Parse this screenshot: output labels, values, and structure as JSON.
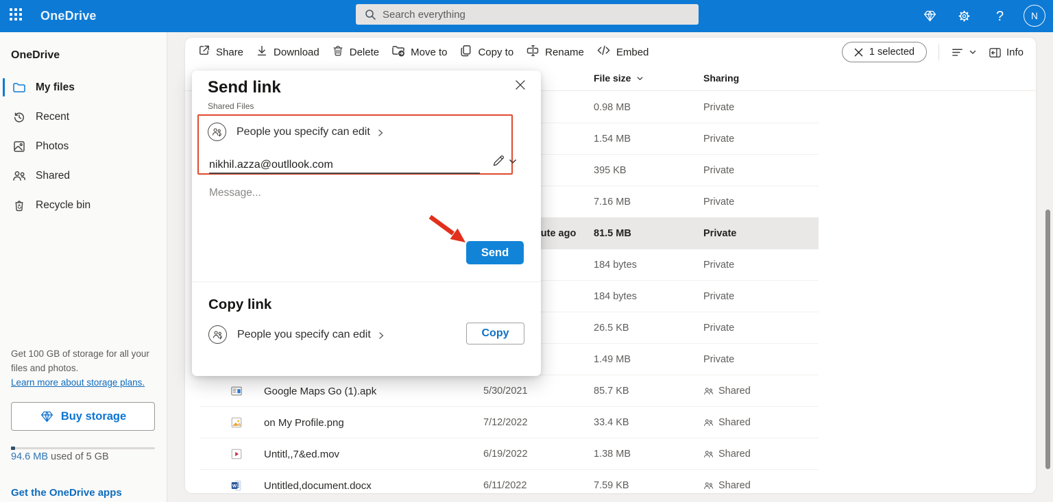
{
  "topbar": {
    "brand": "OneDrive",
    "search_placeholder": "Search everything",
    "avatar_initial": "N"
  },
  "sidebar": {
    "title": "OneDrive",
    "items": [
      {
        "label": "My files",
        "icon": "folder-icon",
        "selected": true
      },
      {
        "label": "Recent",
        "icon": "recent-icon",
        "selected": false
      },
      {
        "label": "Photos",
        "icon": "photos-icon",
        "selected": false
      },
      {
        "label": "Shared",
        "icon": "people-icon",
        "selected": false
      },
      {
        "label": "Recycle bin",
        "icon": "recycle-bin-icon",
        "selected": false
      }
    ],
    "storage": {
      "promo_line1": "Get 100 GB of storage for all your",
      "promo_line2": "files and photos.",
      "learn_more_link": "Learn more about storage plans.",
      "buy_button": "Buy storage",
      "usage_amount": "94.6 MB",
      "usage_rest": " used of 5 GB",
      "apps_link": "Get the OneDrive apps"
    }
  },
  "toolbar": {
    "actions": [
      {
        "label": "Share",
        "icon": "share-icon"
      },
      {
        "label": "Download",
        "icon": "download-icon"
      },
      {
        "label": "Delete",
        "icon": "delete-icon"
      },
      {
        "label": "Move to",
        "icon": "move-to-icon"
      },
      {
        "label": "Copy to",
        "icon": "copy-to-icon"
      },
      {
        "label": "Rename",
        "icon": "rename-icon"
      },
      {
        "label": "Embed",
        "icon": "embed-icon"
      }
    ],
    "selected_count": "1 selected",
    "info_label": "Info"
  },
  "table": {
    "headers": {
      "file_size": "File size",
      "sharing": "Sharing"
    },
    "rows": [
      {
        "name": "",
        "icon": "",
        "modified": "",
        "size": "0.98 MB",
        "sharing": "Private",
        "selected": false
      },
      {
        "name": "",
        "icon": "",
        "modified": "",
        "size": "1.54 MB",
        "sharing": "Private",
        "selected": false
      },
      {
        "name": "",
        "icon": "",
        "modified": "",
        "size": "395 KB",
        "sharing": "Private",
        "selected": false
      },
      {
        "name": "",
        "icon": "",
        "modified": "",
        "size": "7.16 MB",
        "sharing": "Private",
        "selected": false
      },
      {
        "name": "",
        "icon": "",
        "modified": "About a minute ago",
        "size": "81.5 MB",
        "sharing": "Private",
        "selected": true
      },
      {
        "name": "",
        "icon": "",
        "modified": "",
        "size": "184 bytes",
        "sharing": "Private",
        "selected": false
      },
      {
        "name": "",
        "icon": "",
        "modified": "",
        "size": "184 bytes",
        "sharing": "Private",
        "selected": false
      },
      {
        "name": "",
        "icon": "",
        "modified": "",
        "size": "26.5 KB",
        "sharing": "Private",
        "selected": false
      },
      {
        "name": "",
        "icon": "",
        "modified": "",
        "size": "1.49 MB",
        "sharing": "Private",
        "selected": false
      },
      {
        "name": "Google Maps Go (1).apk",
        "icon": "apk-file-icon",
        "modified": "5/30/2021",
        "size": "85.7 KB",
        "sharing": "Shared",
        "selected": false
      },
      {
        "name": "on My Profile.png",
        "icon": "image-file-icon",
        "modified": "7/12/2022",
        "size": "33.4 KB",
        "sharing": "Shared",
        "selected": false
      },
      {
        "name": "Untitl,,7&ed.mov",
        "icon": "video-file-icon",
        "modified": "6/19/2022",
        "size": "1.38 MB",
        "sharing": "Shared",
        "selected": false
      },
      {
        "name": "Untitled,document.docx",
        "icon": "word-file-icon",
        "modified": "6/11/2022",
        "size": "7.59 KB",
        "sharing": "Shared",
        "selected": false
      }
    ]
  },
  "dialog": {
    "title": "Send link",
    "subtitle": "Shared Files",
    "permission_label": "People you specify can edit",
    "email_value": "nikhil.azza@outllook.com",
    "message_placeholder": "Message...",
    "send_button": "Send",
    "copy_section_title": "Copy link",
    "copy_permission_label": "People you specify can edit",
    "copy_button": "Copy"
  },
  "colors": {
    "suite_bar_blue": "#0d7ad5",
    "accent_blue": "#1284d8",
    "annotation_red": "#e2301c",
    "selected_row_bg": "#e9e8e6"
  }
}
